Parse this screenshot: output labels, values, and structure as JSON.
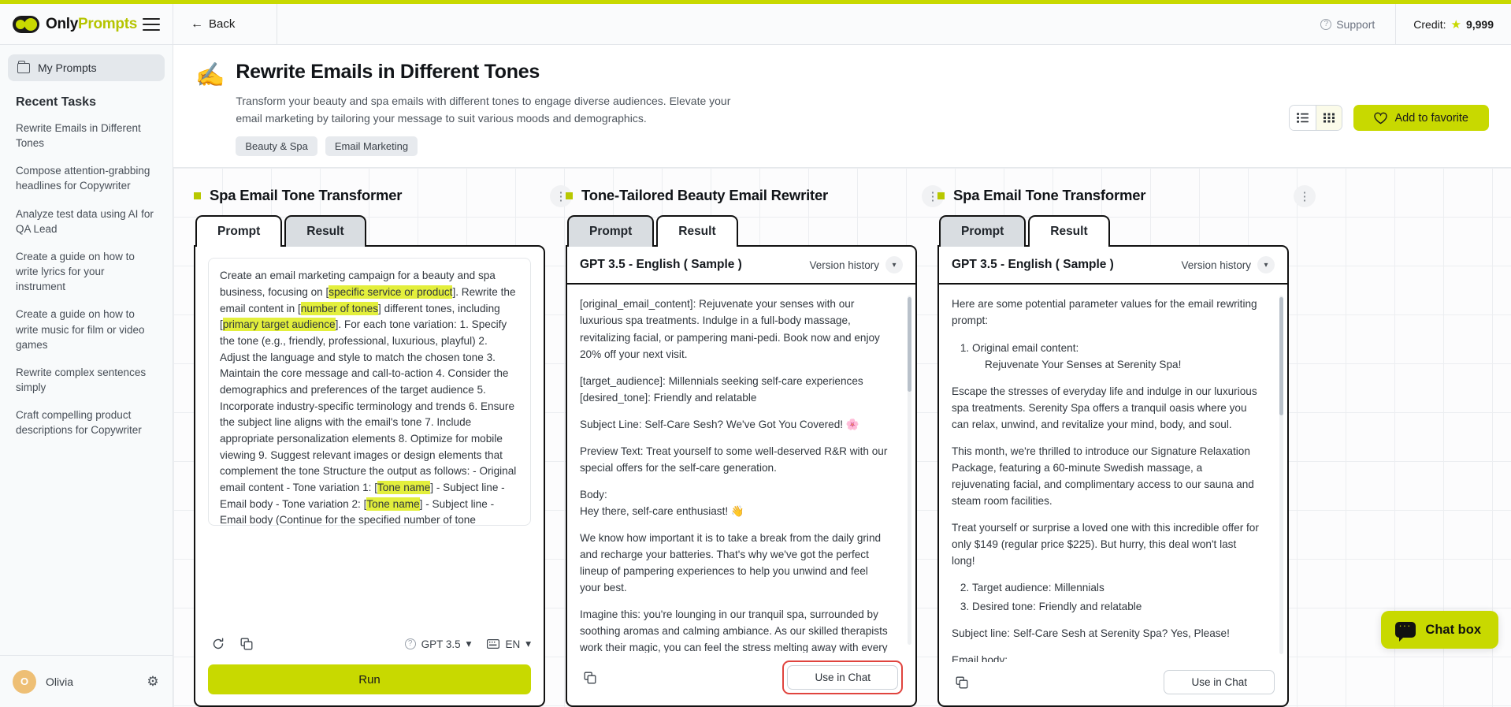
{
  "brand": {
    "name_part1": "Only",
    "name_part2": "Prompts",
    "logo_icon": "toggle-logo-icon",
    "menu_icon": "hamburger-icon"
  },
  "topbar": {
    "back_label": "Back",
    "back_icon": "arrow-left-icon",
    "support_label": "Support",
    "support_icon": "question-circle-icon",
    "credit_label": "Credit:",
    "credit_value": "9,999",
    "credit_icon": "star-icon"
  },
  "sidebar": {
    "my_prompts_label": "My Prompts",
    "my_prompts_icon": "folder-icon",
    "recent_title": "Recent Tasks",
    "tasks": [
      {
        "label": "Rewrite Emails in Different Tones"
      },
      {
        "label": "Compose attention-grabbing headlines for Copywriter"
      },
      {
        "label": "Analyze test data using AI for QA Lead"
      },
      {
        "label": "Create a guide on how to write lyrics for your instrument"
      },
      {
        "label": "Create a guide on how to write music for film or video games"
      },
      {
        "label": "Rewrite complex sentences simply"
      },
      {
        "label": "Craft compelling product descriptions for Copywriter"
      }
    ],
    "user": {
      "initial": "O",
      "name": "Olivia",
      "settings_icon": "gear-icon"
    }
  },
  "page_header": {
    "emoji": "✍️",
    "title": "Rewrite Emails in Different Tones",
    "description": "Transform your beauty and spa emails with different tones to engage diverse audiences. Elevate your email marketing by tailoring your message to suit various moods and demographics.",
    "tags": [
      "Beauty & Spa",
      "Email Marketing"
    ],
    "view_list_icon": "list-view-icon",
    "view_grid_icon": "grid-view-icon",
    "favorite_label": "Add to favorite",
    "favorite_icon": "heart-icon"
  },
  "columns": [
    {
      "title": "Spa Email Tone Transformer",
      "kebab_icon": "more-vertical-icon",
      "tabs": [
        {
          "label": "Prompt",
          "active": true
        },
        {
          "label": "Result",
          "active": false
        }
      ],
      "prompt_segments": [
        {
          "t": "Create an email marketing campaign for a beauty and spa business, focusing on [",
          "h": false
        },
        {
          "t": "specific service or product",
          "h": true
        },
        {
          "t": "]. Rewrite the email content in [",
          "h": false
        },
        {
          "t": "number of tones",
          "h": true
        },
        {
          "t": "] different tones, including [",
          "h": false
        },
        {
          "t": "primary target audience",
          "h": true
        },
        {
          "t": "]. For each tone variation: 1. Specify the tone (e.g., friendly, professional, luxurious, playful) 2. Adjust the language and style to match the chosen tone 3. Maintain the core message and call-to-action 4. Consider the demographics and preferences of the target audience 5. Incorporate industry-specific terminology and trends 6. Ensure the subject line aligns with the email's tone 7. Include appropriate personalization elements 8. Optimize for mobile viewing 9. Suggest relevant images or design elements that complement the tone Structure the output as follows: - Original email content - Tone variation 1: [",
          "h": false
        },
        {
          "t": "Tone name",
          "h": true
        },
        {
          "t": "] - Subject line - Email body - Tone variation 2: [",
          "h": false
        },
        {
          "t": "Tone name",
          "h": true
        },
        {
          "t": "] - Subject line - Email body (Continue for the specified number of tone variations) Key considerations: - Brand voice consistency - Industry regulations and best practices - Emotional appeal and persuasive techniques - Seasonal or time-sensitive offers -",
          "h": false
        }
      ],
      "footer": {
        "refresh_icon": "refresh-icon",
        "copy_icon": "copy-icon",
        "model_label": "GPT 3.5",
        "model_help_icon": "question-circle-icon",
        "model_chevron_icon": "chevron-down-icon",
        "lang_label": "EN",
        "lang_icon": "keyboard-icon",
        "lang_chevron_icon": "chevron-down-icon",
        "run_label": "Run"
      }
    },
    {
      "title": "Tone-Tailored Beauty Email Rewriter",
      "kebab_icon": "more-vertical-icon",
      "tabs": [
        {
          "label": "Prompt",
          "active": false
        },
        {
          "label": "Result",
          "active": true
        }
      ],
      "result_header": "GPT 3.5 - English ( Sample )",
      "version_history_label": "Version history",
      "version_history_icon": "chevron-down-icon",
      "result_paragraphs": [
        "[original_email_content]: Rejuvenate your senses with our luxurious spa treatments. Indulge in a full-body massage, revitalizing facial, or pampering mani-pedi. Book now and enjoy 20% off your next visit.",
        "[target_audience]: Millennials seeking self-care experiences\n[desired_tone]: Friendly and relatable",
        "Subject Line: Self-Care Sesh? We've Got You Covered! 🌸",
        "Preview Text: Treat yourself to some well-deserved R&R with our special offers for the self-care generation.",
        "Body:\nHey there, self-care enthusiast! 👋",
        "We know how important it is to take a break from the daily grind and recharge your batteries. That's why we've got the perfect lineup of pampering experiences to help you unwind and feel your best.",
        "Imagine this: you're lounging in our tranquil spa, surrounded by soothing aromas and calming ambiance. As our skilled therapists work their magic, you can feel the stress melting away with every stroke of their hands. It's the ultimate escape from the hustle and bustle of"
      ],
      "copy_icon": "copy-icon",
      "use_in_chat_label": "Use in Chat",
      "use_in_chat_highlighted": true
    },
    {
      "title": "Spa Email Tone Transformer",
      "kebab_icon": "more-vertical-icon",
      "tabs": [
        {
          "label": "Prompt",
          "active": false
        },
        {
          "label": "Result",
          "active": true
        }
      ],
      "result_header": "GPT 3.5 - English ( Sample )",
      "version_history_label": "Version history",
      "version_history_icon": "chevron-down-icon",
      "result_intro": "Here are some potential parameter values for the email rewriting prompt:",
      "result_list_1": [
        "Original email content:"
      ],
      "result_list_1_sub": "Rejuvenate Your Senses at Serenity Spa!",
      "result_paragraphs_mid": [
        "Escape the stresses of everyday life and indulge in our luxurious spa treatments. Serenity Spa offers a tranquil oasis where you can relax, unwind, and revitalize your mind, body, and soul.",
        "This month, we're thrilled to introduce our Signature Relaxation Package, featuring a 60-minute Swedish massage, a rejuvenating facial, and complimentary access to our sauna and steam room facilities.",
        "Treat yourself or surprise a loved one with this incredible offer for only $149 (regular price $225). But hurry, this deal won't last long!"
      ],
      "result_list_2": [
        "Target audience: Millennials",
        "Desired tone: Friendly and relatable"
      ],
      "result_tail": [
        "Subject line: Self-Care Sesh at Serenity Spa? Yes, Please!",
        "Email body:"
      ],
      "copy_icon": "copy-icon",
      "use_in_chat_label": "Use in Chat",
      "use_in_chat_highlighted": false
    }
  ],
  "chatbox": {
    "label": "Chat box",
    "icon": "chat-bubble-icon"
  },
  "colors": {
    "accent": "#c8d900",
    "highlight": "#e3ef3c",
    "danger": "#e0443e",
    "avatar": "#eebf75"
  }
}
